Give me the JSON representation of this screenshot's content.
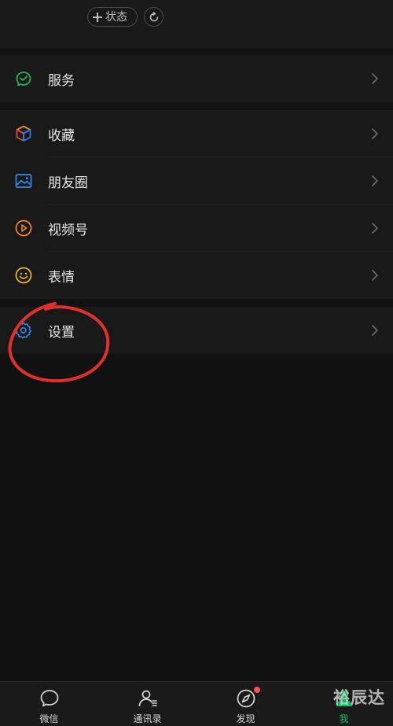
{
  "profile": {
    "status_label": "状态"
  },
  "groups": [
    {
      "items": [
        {
          "label": "服务",
          "icon": "wechat-pay-icon"
        }
      ]
    },
    {
      "items": [
        {
          "label": "收藏",
          "icon": "favorites-cube-icon"
        },
        {
          "label": "朋友圈",
          "icon": "moments-image-icon"
        },
        {
          "label": "视频号",
          "icon": "channels-play-icon"
        },
        {
          "label": "表情",
          "icon": "sticker-smile-icon"
        }
      ]
    },
    {
      "items": [
        {
          "label": "设置",
          "icon": "gear-icon"
        }
      ]
    }
  ],
  "tabbar": {
    "tabs": [
      {
        "label": "微信",
        "icon": "chat-bubble-icon"
      },
      {
        "label": "通讯录",
        "icon": "contacts-icon"
      },
      {
        "label": "发现",
        "icon": "compass-icon"
      },
      {
        "label": "我",
        "icon": "me-person-icon"
      }
    ]
  },
  "watermark": "裕辰达",
  "colors": {
    "background": "#111111",
    "cell": "#191919",
    "active_green": "#07c160",
    "badge_red": "#fa5151",
    "annotation_red": "#e0302a"
  }
}
